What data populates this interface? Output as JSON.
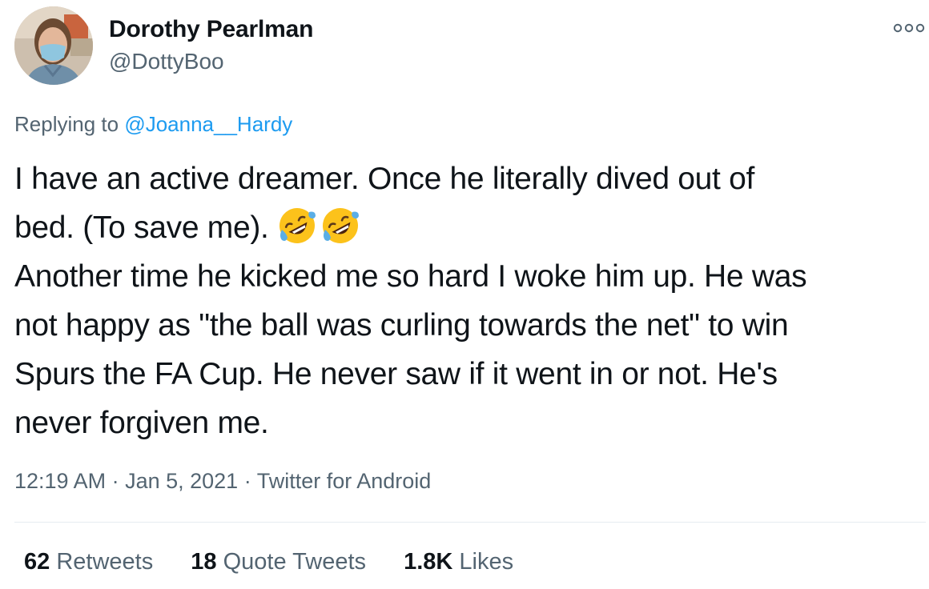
{
  "author": {
    "display_name": "Dorothy Pearlman",
    "handle": "@DottyBoo",
    "avatar_icon": "profile-photo"
  },
  "menu_icon": "more-options-icon",
  "reply": {
    "prefix": "Replying to ",
    "mention": "@Joanna__Hardy"
  },
  "tweet": {
    "lines": [
      "I have an active dreamer. Once he literally dived out of",
      "bed. (To save me). ",
      "Another time he kicked me so hard I woke him up. He was",
      "not happy as \"the ball was curling towards the net\" to win",
      "Spurs the FA Cup. He never saw if it went in or not. He's",
      "never forgiven me."
    ],
    "emojis": [
      "rolling-on-floor-laughing-emoji",
      "rolling-on-floor-laughing-emoji"
    ]
  },
  "meta": {
    "time": "12:19 AM",
    "separator": " · ",
    "date": "Jan 5, 2021",
    "source": "Twitter for Android"
  },
  "stats": {
    "retweets_count": "62",
    "retweets_label": "Retweets",
    "quotes_count": "18",
    "quotes_label": "Quote Tweets",
    "likes_count": "1.8K",
    "likes_label": "Likes"
  },
  "colors": {
    "text": "#0f1419",
    "secondary": "#536471",
    "link": "#1d9bf0",
    "divider": "#e6ecf0"
  }
}
